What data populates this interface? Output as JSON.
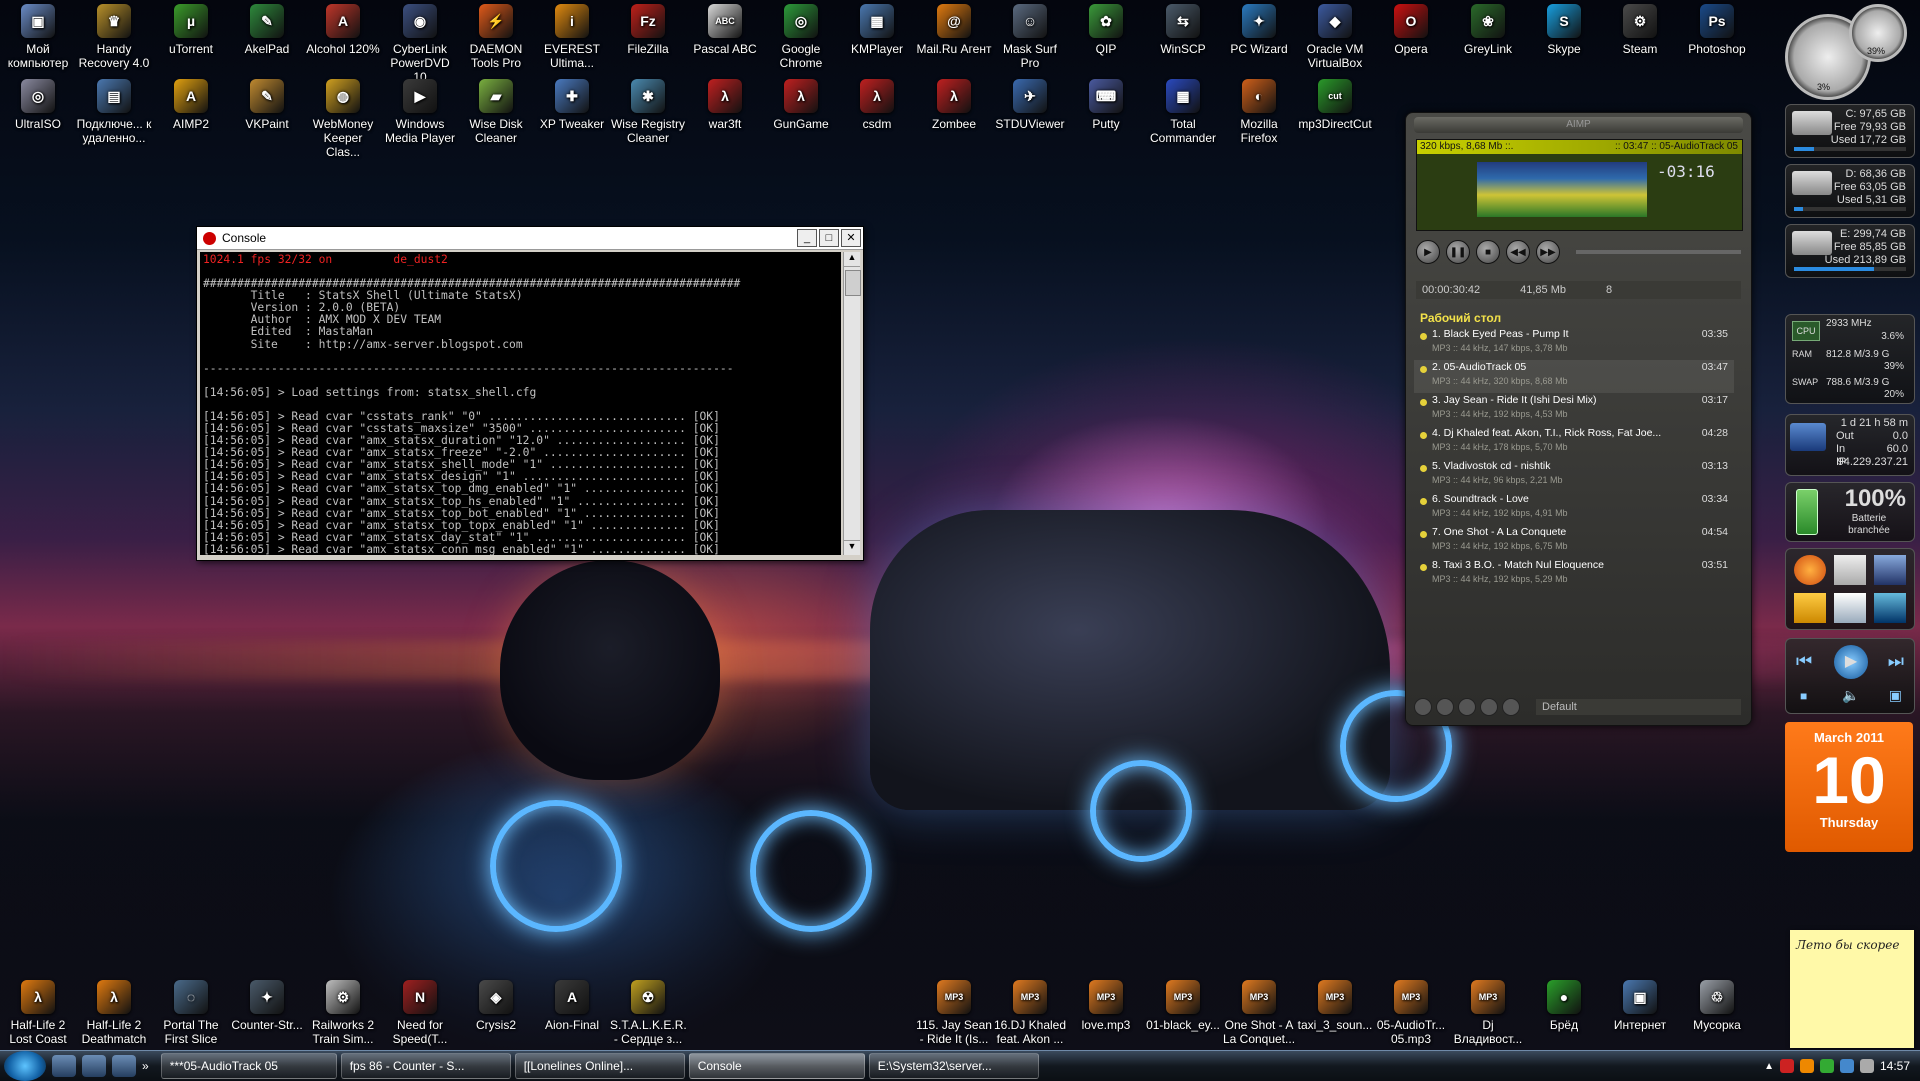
{
  "desktop": {
    "top_icons": [
      {
        "label": "Мой компьютер",
        "glyph": "▣",
        "color": "#6a8cc7"
      },
      {
        "label": "Handy Recovery 4.0",
        "glyph": "♛",
        "color": "#b8902a"
      },
      {
        "label": "uTorrent",
        "glyph": "µ",
        "color": "#3a9c2a"
      },
      {
        "label": "AkelPad",
        "glyph": "✎",
        "color": "#2e8a3c"
      },
      {
        "label": "Alcohol 120%",
        "glyph": "A",
        "color": "#c0362a"
      },
      {
        "label": "CyberLink PowerDVD 10",
        "glyph": "◉",
        "color": "#3b4f80"
      },
      {
        "label": "DAEMON Tools Pro",
        "glyph": "⚡",
        "color": "#e05a1a"
      },
      {
        "label": "EVEREST Ultima...",
        "glyph": "i",
        "color": "#e08a10"
      },
      {
        "label": "FileZilla",
        "glyph": "Fz",
        "color": "#c0201a"
      },
      {
        "label": "Pascal ABC",
        "glyph": "ABC",
        "color": "#d8d8d8"
      },
      {
        "label": "Google Chrome",
        "glyph": "◎",
        "color": "#2c9a3a"
      },
      {
        "label": "KMPlayer",
        "glyph": "▦",
        "color": "#4a78b0"
      },
      {
        "label": "Mail.Ru Агент",
        "glyph": "@",
        "color": "#e07a10"
      },
      {
        "label": "Mask Surf Pro",
        "glyph": "☺",
        "color": "#5a6a80"
      },
      {
        "label": "QIP",
        "glyph": "✿",
        "color": "#3a9a3a"
      },
      {
        "label": "WinSCP",
        "glyph": "⇆",
        "color": "#4a5a6a"
      },
      {
        "label": "PC Wizard",
        "glyph": "✦",
        "color": "#2a7ac0"
      },
      {
        "label": "Oracle VM VirtualBox",
        "glyph": "◆",
        "color": "#3c5aa0"
      },
      {
        "label": "Opera",
        "glyph": "O",
        "color": "#cc1010"
      },
      {
        "label": "GreyLink",
        "glyph": "❀",
        "color": "#2a6a2a"
      },
      {
        "label": "Skype",
        "glyph": "S",
        "color": "#18a0e0"
      },
      {
        "label": "Steam",
        "glyph": "⚙",
        "color": "#4a4a4a"
      },
      {
        "label": "Photoshop",
        "glyph": "Ps",
        "color": "#1a4a8a"
      }
    ],
    "second_icons": [
      {
        "label": "UltraISO",
        "glyph": "◎",
        "color": "#8a8aa0"
      },
      {
        "label": "Подключе... к удаленно...",
        "glyph": "▤",
        "color": "#4a78b0"
      },
      {
        "label": "AIMP2",
        "glyph": "A",
        "color": "#e0a010"
      },
      {
        "label": "VKPaint",
        "glyph": "✎",
        "color": "#c08a30"
      },
      {
        "label": "WebMoney Keeper Clas...",
        "glyph": "◍",
        "color": "#d0a020"
      },
      {
        "label": "Windows Media Player",
        "glyph": "▶",
        "color": "#3a3a3a"
      },
      {
        "label": "Wise Disk Cleaner",
        "glyph": "▰",
        "color": "#7ab040"
      },
      {
        "label": "XP Tweaker",
        "glyph": "✚",
        "color": "#4a7ac0"
      },
      {
        "label": "Wise Registry Cleaner",
        "glyph": "✱",
        "color": "#4a8ab0"
      },
      {
        "label": "war3ft",
        "glyph": "λ",
        "color": "#c02020"
      },
      {
        "label": "GunGame",
        "glyph": "λ",
        "color": "#c02020"
      },
      {
        "label": "csdm",
        "glyph": "λ",
        "color": "#c02020"
      },
      {
        "label": "Zombee",
        "glyph": "λ",
        "color": "#c02020"
      },
      {
        "label": "STDUViewer",
        "glyph": "✈",
        "color": "#3a6ab0"
      },
      {
        "label": "Putty",
        "glyph": "⌨",
        "color": "#4a5aa0"
      },
      {
        "label": "Total Commander",
        "glyph": "▦",
        "color": "#2a4ac0"
      },
      {
        "label": "Mozilla Firefox",
        "glyph": "◐",
        "color": "#d0601a"
      },
      {
        "label": "mp3DirectCut",
        "glyph": "cut",
        "color": "#2a9a2a"
      }
    ],
    "bottom_icons": [
      {
        "label": "Half-Life 2 Lost Coast",
        "glyph": "λ",
        "color": "#e07a10"
      },
      {
        "label": "Half-Life 2 Deathmatch",
        "glyph": "λ",
        "color": "#e07a10"
      },
      {
        "label": "Portal The First Slice",
        "glyph": "◌",
        "color": "#4a6a8a"
      },
      {
        "label": "Counter-Str...",
        "glyph": "✦",
        "color": "#4a5a6a"
      },
      {
        "label": "Railworks 2 Train Sim...",
        "glyph": "⚙",
        "color": "#c0c0c0"
      },
      {
        "label": "Need for Speed(T...",
        "glyph": "N",
        "color": "#a02020"
      },
      {
        "label": "Crysis2",
        "glyph": "◈",
        "color": "#4a4a4a"
      },
      {
        "label": "Aion-Final",
        "glyph": "A",
        "color": "#3a3a3a"
      },
      {
        "label": "S.T.A.L.K.E.R. - Сердце з...",
        "glyph": "☢",
        "color": "#c0a020"
      },
      {
        "label": "115. Jay Sean - Ride It (Is...",
        "glyph": "MP3",
        "color": "#e07a20"
      },
      {
        "label": "16.DJ Khaled feat. Akon ...",
        "glyph": "MP3",
        "color": "#e07a20"
      },
      {
        "label": "love.mp3",
        "glyph": "MP3",
        "color": "#e07a20"
      },
      {
        "label": "01-black_ey...",
        "glyph": "MP3",
        "color": "#e07a20"
      },
      {
        "label": "One Shot - A La Conquet...",
        "glyph": "MP3",
        "color": "#e07a20"
      },
      {
        "label": "taxi_3_soun...",
        "glyph": "MP3",
        "color": "#e07a20"
      },
      {
        "label": "05-AudioTr... 05.mp3",
        "glyph": "MP3",
        "color": "#e07a20"
      },
      {
        "label": "Dj Владивост...",
        "glyph": "MP3",
        "color": "#e07a20"
      },
      {
        "label": "Брёд",
        "glyph": "●",
        "color": "#2aa02a"
      },
      {
        "label": "Интернет",
        "glyph": "▣",
        "color": "#4a78b0"
      },
      {
        "label": "Мусорка",
        "glyph": "♲",
        "color": "#9aa0a8"
      }
    ]
  },
  "console": {
    "title": "Console",
    "header_line": "1024.1 fps 32/32 on         de_dust2",
    "lines": [
      "",
      "###############################################################################",
      "       Title   : StatsX Shell (Ultimate StatsX)",
      "       Version : 2.0.0 (BETA)",
      "       Author  : AMX MOD X DEV TEAM",
      "       Edited  : MastaMan",
      "       Site    : http://amx-server.blogspot.com",
      "",
      "------------------------------------------------------------------------------",
      "",
      "[14:56:05] > Load settings from: statsx_shell.cfg",
      "",
      "[14:56:05] > Read cvar \"csstats_rank\" \"0\" ............................. [OK]",
      "[14:56:05] > Read cvar \"csstats_maxsize\" \"3500\" ....................... [OK]",
      "[14:56:05] > Read cvar \"amx_statsx_duration\" \"12.0\" ................... [OK]",
      "[14:56:05] > Read cvar \"amx_statsx_freeze\" \"-2.0\" ..................... [OK]",
      "[14:56:05] > Read cvar \"amx_statsx_shell_mode\" \"1\" .................... [OK]",
      "[14:56:05] > Read cvar \"amx_statsx_design\" \"1\" ........................ [OK]",
      "[14:56:05] > Read cvar \"amx_statsx_top_dmg_enabled\" \"1\" ............... [OK]",
      "[14:56:05] > Read cvar \"amx_statsx_top_hs_enabled\" \"1\" ................ [OK]",
      "[14:56:05] > Read cvar \"amx_statsx_top_bot_enabled\" \"1\" ............... [OK]",
      "[14:56:05] > Read cvar \"amx_statsx_top_topx_enabled\" \"1\" .............. [OK]",
      "[14:56:05] > Read cvar \"amx_statsx_day_stat\" \"1\" ...................... [OK]",
      "[14:56:05] > Read cvar \"amx_statsx_conn_msg_enabled\" \"1\" .............. [OK]"
    ]
  },
  "aimp": {
    "title": "AIMP",
    "lcd_left": "320 kbps, 8,68 Mb ::.",
    "lcd_right": ":: 03:47 :: 05-AudioTrack 05",
    "time": "-03:16",
    "elapsed": "00:00:30:42",
    "size": "41,85 Mb",
    "count": "8",
    "playlist_title": "Рабочий стол",
    "tracks": [
      {
        "title": "1. Black Eyed Peas - Pump It",
        "dur": "03:35",
        "meta": "MP3 :: 44 kHz, 147 kbps, 3,78 Mb"
      },
      {
        "title": "2. 05-AudioTrack 05",
        "dur": "03:47",
        "meta": "MP3 :: 44 kHz, 320 kbps, 8,68 Mb"
      },
      {
        "title": "3. Jay Sean - Ride It (Ishi Desi Mix)",
        "dur": "03:17",
        "meta": "MP3 :: 44 kHz, 192 kbps, 4,53 Mb"
      },
      {
        "title": "4. Dj Khaled feat. Akon, T.I., Rick Ross, Fat Joe...",
        "dur": "04:28",
        "meta": "MP3 :: 44 kHz, 178 kbps, 5,70 Mb"
      },
      {
        "title": "5. Vladivostok cd - nishtik",
        "dur": "03:13",
        "meta": "MP3 :: 44 kHz, 96 kbps, 2,21 Mb"
      },
      {
        "title": "6. Soundtrack - Love",
        "dur": "03:34",
        "meta": "MP3 :: 44 kHz, 192 kbps, 4,91 Mb"
      },
      {
        "title": "7. One Shot - A La Conquete",
        "dur": "04:54",
        "meta": "MP3 :: 44 kHz, 192 kbps, 6,75 Mb"
      },
      {
        "title": "8. Taxi 3 B.O. - Match Nul Eloquence",
        "dur": "03:51",
        "meta": "MP3 :: 44 kHz, 192 kbps, 5,29 Mb"
      }
    ],
    "selected_index": 1,
    "preset": "Default"
  },
  "gadgets": {
    "gauge_pct_a": "3%",
    "gauge_pct_b": "39%",
    "drives": [
      {
        "line1": "C: 97,65 GB",
        "line2": "Free 79,93 GB",
        "line3": "Used 17,72 GB",
        "used_fraction": 0.18
      },
      {
        "line1": "D: 68,36 GB",
        "line2": "Free 63,05 GB",
        "line3": "Used 5,31 GB",
        "used_fraction": 0.08
      },
      {
        "line1": "E: 299,74 GB",
        "line2": "Free 85,85 GB",
        "line3": "Used 213,89 GB",
        "used_fraction": 0.71
      }
    ],
    "cpu": {
      "label": "CPU",
      "mhz": "2933 MHz",
      "pct": "3.6%"
    },
    "ram": {
      "label": "RAM",
      "val": "812.8 M/3.9 G",
      "pct": "39%"
    },
    "swap": {
      "label": "SWAP",
      "val": "788.6 M/3.9 G",
      "pct": "20%"
    },
    "net": {
      "uptime": "1 d 21 h 58 m",
      "out_label": "Out",
      "out": "0.0",
      "in_label": "In",
      "in": "60.0",
      "ip_label": "IP",
      "ip": "94.229.237.21"
    },
    "battery": {
      "pct": "100%",
      "status": "Batterie branchée"
    },
    "calendar": {
      "month": "March 2011",
      "day": "10",
      "weekday": "Thursday"
    },
    "note": "Лето бы скорее"
  },
  "taskbar": {
    "buttons": [
      "***05-AudioTrack 05",
      "fps 86 - Counter - S...",
      "[[Lonelines Online]...",
      "Console",
      "E:\\System32\\server..."
    ],
    "active_index": 3,
    "clock": "14:57"
  }
}
